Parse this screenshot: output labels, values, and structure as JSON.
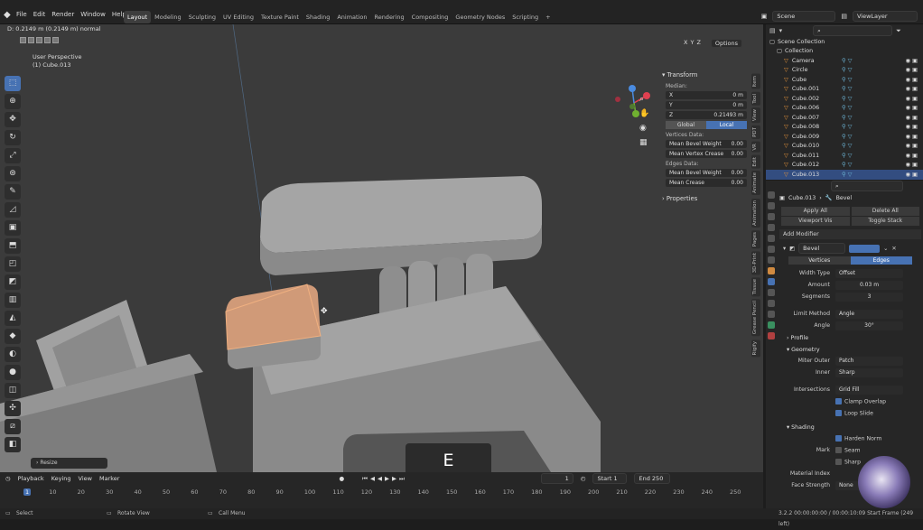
{
  "app": {
    "logo": "blender-icon"
  },
  "menu": [
    "File",
    "Edit",
    "Render",
    "Window",
    "Help"
  ],
  "workspaces": [
    "Layout",
    "Modeling",
    "Sculpting",
    "UV Editing",
    "Texture Paint",
    "Shading",
    "Animation",
    "Rendering",
    "Compositing",
    "Geometry Nodes",
    "Scripting",
    "+"
  ],
  "active_workspace": "Layout",
  "top_right": {
    "scene": "Scene",
    "view_layer": "ViewLayer"
  },
  "viewport": {
    "header_text": "D: 0.2149 m (0.2149 m) normal",
    "perspective": "User Perspective",
    "object": "(1) Cube.013",
    "options": "Options",
    "caption": "E (Extrude)",
    "resize_panel": "Resize"
  },
  "npanel": {
    "transform_title": "Transform",
    "median_label": "Median:",
    "x": {
      "label": "X",
      "value": "0 m"
    },
    "y": {
      "label": "Y",
      "value": "0 m"
    },
    "z": {
      "label": "Z",
      "value": "0.21493 m"
    },
    "global": "Global",
    "local": "Local",
    "vertices_data": "Vertices Data:",
    "mean_bevel_weight_label": "Mean Bevel Weight",
    "mean_bevel_weight": "0.00",
    "mean_vertex_crease_label": "Mean Vertex Crease",
    "mean_vertex_crease": "0.00",
    "edges_data": "Edges Data:",
    "edge_mean_bevel_weight_label": "Mean Bevel Weight",
    "edge_mean_bevel_weight": "0.00",
    "mean_crease_label": "Mean Crease",
    "mean_crease": "0.00",
    "properties": "Properties",
    "side_tabs": [
      "Item",
      "Tool",
      "View",
      "PDT",
      "VR",
      "Edit",
      "Animate",
      "Animation",
      "Pages",
      "3D-Print",
      "Tissue",
      "Grease Pencil",
      "Rigify"
    ]
  },
  "timeline": {
    "playback": "Playback",
    "keying": "Keying",
    "view": "View",
    "marker": "Marker",
    "current_frame": "1",
    "start_label": "Start",
    "start": "1",
    "end_label": "End",
    "end": "250",
    "ticks": [
      "1",
      "10",
      "20",
      "30",
      "40",
      "50",
      "60",
      "70",
      "80",
      "90",
      "100",
      "110",
      "120",
      "130",
      "140",
      "150",
      "160",
      "170",
      "180",
      "190",
      "200",
      "210",
      "220",
      "230",
      "240",
      "250"
    ]
  },
  "statusbar": {
    "select": "Select",
    "rotate": "Rotate View",
    "call_menu": "Call Menu",
    "info": "3.2.2  00:00:00:00 / 00:00:10:09  Start Frame (249 left)"
  },
  "outliner": {
    "scene_collection": "Scene Collection",
    "collection": "Collection",
    "items": [
      "Camera",
      "Circle",
      "Cube",
      "Cube.001",
      "Cube.002",
      "Cube.006",
      "Cube.007",
      "Cube.008",
      "Cube.009",
      "Cube.010",
      "Cube.011",
      "Cube.012",
      "Cube.013"
    ],
    "selected": "Cube.013"
  },
  "properties": {
    "object": "Cube.013",
    "modifier": "Bevel",
    "apply_all": "Apply All",
    "delete_all": "Delete All",
    "viewport_vis": "Viewport Vis",
    "toggle_stack": "Toggle Stack",
    "add_modifier": "Add Modifier",
    "modifier_name": "Bevel",
    "vertices": "Vertices",
    "edges": "Edges",
    "width_type_label": "Width Type",
    "width_type": "Offset",
    "amount_label": "Amount",
    "amount": "0.03 m",
    "segments_label": "Segments",
    "segments": "3",
    "limit_method_label": "Limit Method",
    "limit_method": "Angle",
    "angle_label": "Angle",
    "angle": "30°",
    "profile": "Profile",
    "geometry": "Geometry",
    "miter_outer_label": "Miter Outer",
    "miter_outer": "Patch",
    "inner_label": "Inner",
    "inner": "Sharp",
    "intersections_label": "Intersections",
    "intersections": "Grid Fill",
    "clamp_overlap": "Clamp Overlap",
    "loop_slide": "Loop Slide",
    "shading": "Shading",
    "harden_normals": "Harden Norm",
    "mark_label": "Mark",
    "seam": "Seam",
    "sharp": "Sharp",
    "material_index_label": "Material Index",
    "face_strength_label": "Face Strength",
    "face_strength": "None"
  },
  "colors": {
    "accent": "#4772b3",
    "selected_face": "#d09a78",
    "viewport_bg": "#3b3b3b"
  }
}
